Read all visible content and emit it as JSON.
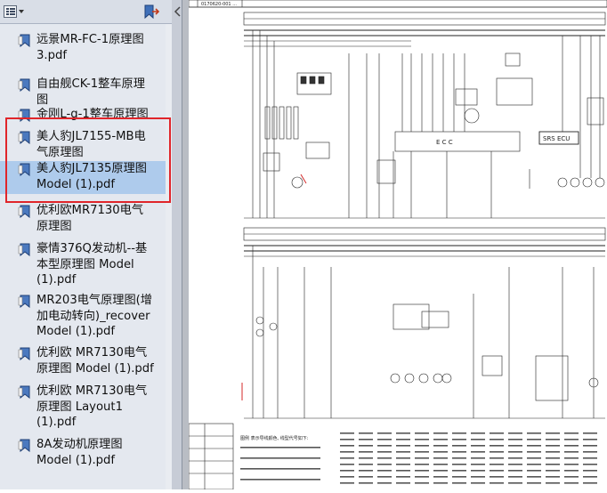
{
  "toolbar": {
    "options_icon": "options-menu-icon",
    "dropdown_icon": "chevron-down-icon",
    "bookmark_icon": "bookmark-icon"
  },
  "bookmarks": [
    {
      "label": "远景MR-FC-1原理图\n3.pdf",
      "selected": false
    },
    {
      "label": "自由舰CK-1整车原理\n图",
      "selected": false
    },
    {
      "label": "金刚L-g-1整车原理图",
      "selected": false
    },
    {
      "label": "美人豹JL7155-MB电\n气原理图",
      "selected": false
    },
    {
      "label": "美人豹JL7135原理图\nModel (1).pdf",
      "selected": true
    },
    {
      "label": "优利欧MR7130电气\n原理图",
      "selected": false
    },
    {
      "label": "豪情376Q发动机--基\n本型原理图 Model\n(1).pdf",
      "selected": false
    },
    {
      "label": "MR203电气原理图(增\n加电动转向)_recover\nModel (1).pdf",
      "selected": false
    },
    {
      "label": "优利欧 MR7130电气\n原理图 Model (1).pdf",
      "selected": false
    },
    {
      "label": "优利欧 MR7130电气\n原理图 Layout1\n(1).pdf",
      "selected": false
    },
    {
      "label": "8A发动机原理图\nModel (1).pdf",
      "selected": false
    }
  ],
  "document": {
    "top_label": "0170620-001 ...",
    "ecu_label": "SRS ECU",
    "module_letters": "E  C  C",
    "legend_title": "图例 表示导线颜色, 线型代号如下:"
  },
  "colors": {
    "sidebar_bg": "#e4e8ef",
    "selection": "#aecbec",
    "highlight": "#e0252a",
    "accent_red": "#d42a2a"
  }
}
